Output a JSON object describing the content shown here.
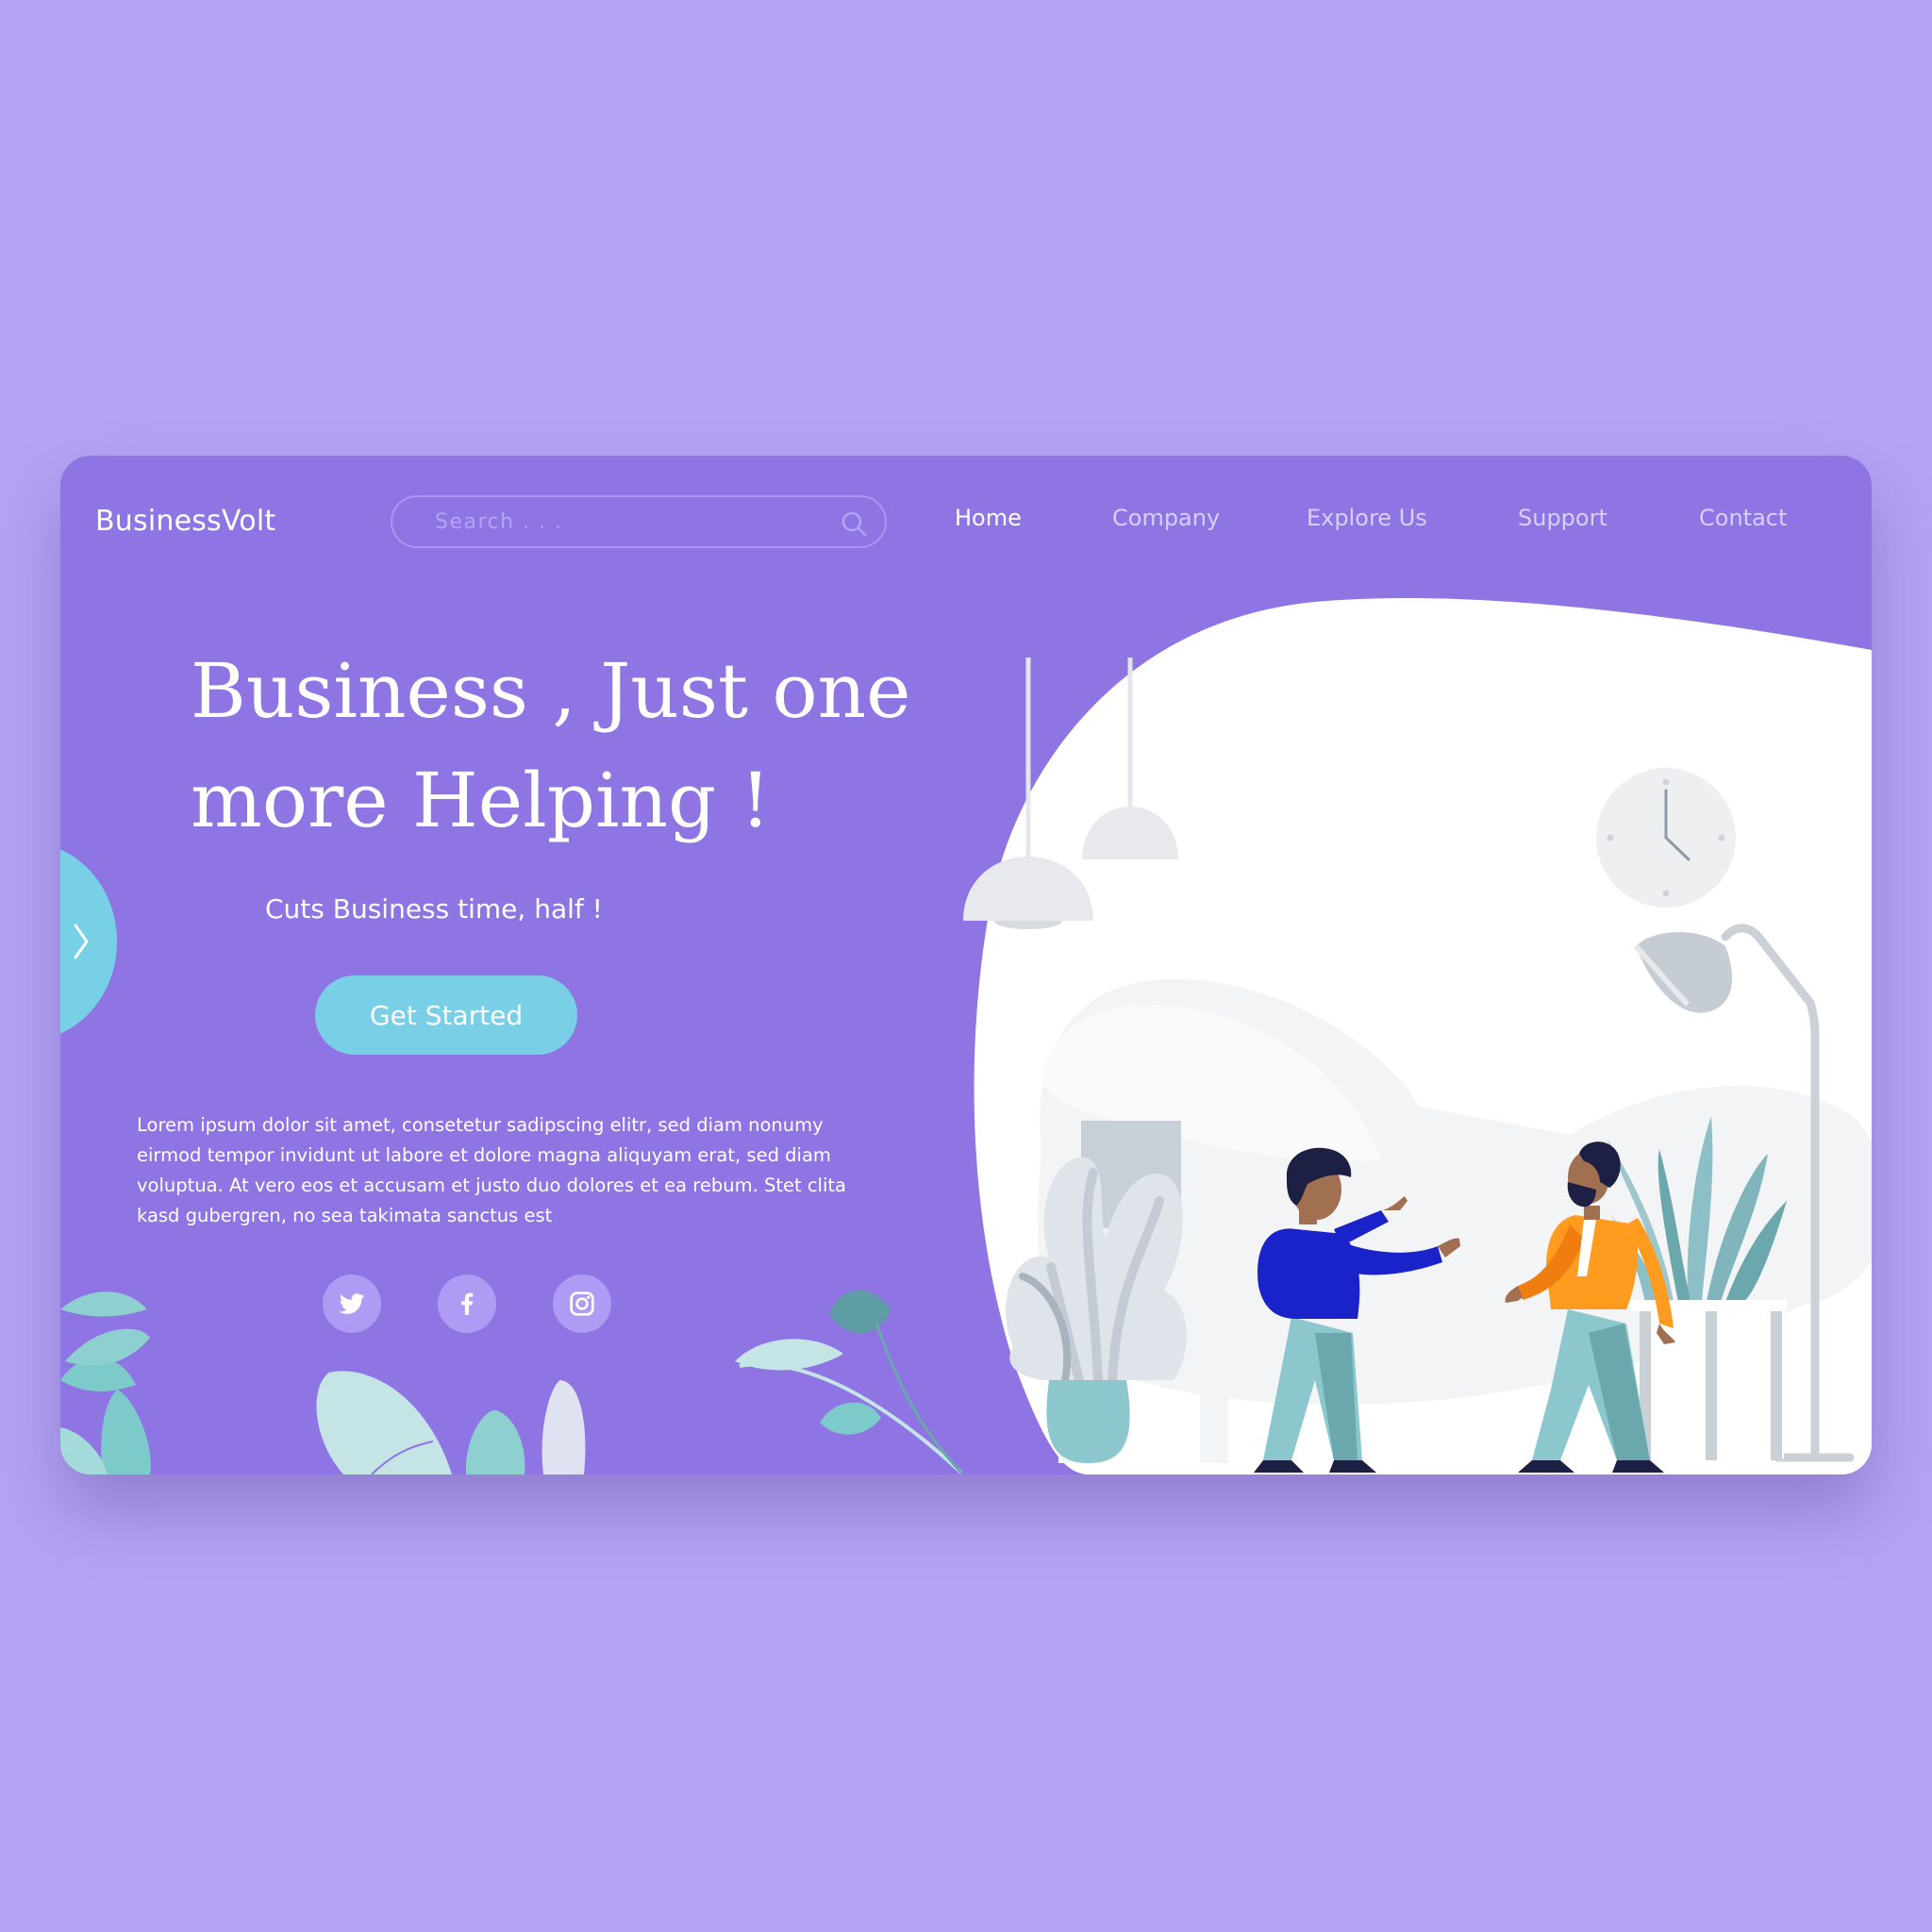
{
  "brand": "BusinessVolt",
  "search": {
    "placeholder": "Search . . ."
  },
  "nav": {
    "items": [
      "Home",
      "Company",
      "Explore Us",
      "Support",
      "Contact"
    ],
    "active": "Home"
  },
  "hero": {
    "title_line1": "Business , Just one",
    "title_line2": "more Helping !",
    "subtitle": "Cuts Business time, half !",
    "cta": "Get Started",
    "body": "Lorem ipsum dolor sit amet, consetetur sadipscing elitr, sed diam nonumy eirmod tempor invidunt ut labore et dolore magna aliquyam erat, sed diam voluptua. At vero eos et accusam et justo duo dolores et ea rebum. Stet clita kasd gubergren, no sea takimata sanctus est"
  },
  "social": {
    "icons": [
      "twitter-icon",
      "facebook-icon",
      "instagram-icon"
    ]
  },
  "colors": {
    "page_background": "#b5a4f3",
    "card_background": "#8f75e3",
    "accent": "#79cfe6",
    "social_circle": "#ad9bf4",
    "jacket_blue": "#1a22c9",
    "jacket_orange": "#ff9b1f",
    "pants_teal": "#8cc7cd"
  }
}
